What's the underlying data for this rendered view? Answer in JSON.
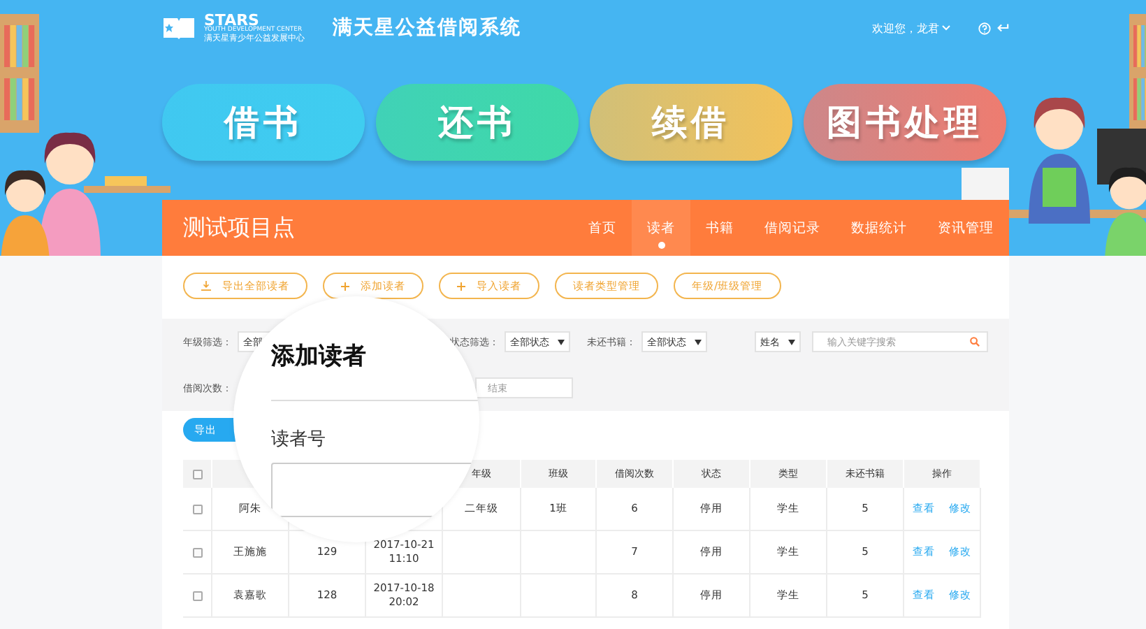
{
  "header": {
    "logo": {
      "name": "STARS",
      "subtitle": "YOUTH DEVELOPMENT CENTER",
      "subtitle_cn": "满天星青少年公益发展中心"
    },
    "title": "满天星公益借阅系统",
    "user": "欢迎您，龙君"
  },
  "actions": [
    {
      "label": "借书",
      "color": "#3fcdf0"
    },
    {
      "label": "还书",
      "color": "#3fd9a8"
    },
    {
      "label": "续借",
      "color": "#f3c25a"
    },
    {
      "label": "图书处理",
      "color": "#ee7c70"
    }
  ],
  "site": {
    "name": "测试项目点",
    "nav": [
      {
        "label": "首页",
        "selected": false
      },
      {
        "label": "读者",
        "selected": true
      },
      {
        "label": "书籍",
        "selected": false
      },
      {
        "label": "借阅记录",
        "selected": false
      },
      {
        "label": "数据统计",
        "selected": false
      },
      {
        "label": "资讯管理",
        "selected": false
      }
    ]
  },
  "toolbar": [
    {
      "label": "导出全部读者",
      "kind": "download"
    },
    {
      "label": "添加读者",
      "kind": "add"
    },
    {
      "label": "导入读者",
      "kind": "add"
    },
    {
      "label": "读者类型管理",
      "kind": "plain"
    },
    {
      "label": "年级/班级管理",
      "kind": "plain"
    }
  ],
  "filters": [
    {
      "label": "年级筛选：",
      "value": "全部"
    },
    {
      "label": "状态筛选：",
      "value": "全部状态"
    },
    {
      "label": "未还书籍：",
      "value": "全部状态"
    }
  ],
  "search": {
    "field": "姓名",
    "placeholder": "输入关键字搜索"
  },
  "borrow_count": {
    "label": "借阅次数：",
    "end_placeholder": "结束"
  },
  "export_button": "导出",
  "table": {
    "all_checked": false,
    "columns": [
      "年级",
      "班级",
      "借阅次数",
      "状态",
      "类型",
      "未还书籍",
      "操作"
    ],
    "rows": [
      {
        "checked": false,
        "name": "阿朱",
        "grade": "二年级",
        "class": "1班",
        "count": "6",
        "status": "停用",
        "type": "学生",
        "unreturned": "5",
        "actions": [
          "查看",
          "修改"
        ]
      },
      {
        "checked": false,
        "name": "王施施",
        "number": "129",
        "date": "2017-10-21 11:10",
        "count": "7",
        "status": "停用",
        "type": "学生",
        "unreturned": "5",
        "actions": [
          "查看",
          "修改"
        ]
      },
      {
        "checked": false,
        "name": "袁嘉歌",
        "number": "128",
        "date": "2017-10-18 20:02",
        "count": "8",
        "status": "停用",
        "type": "学生",
        "unreturned": "5",
        "actions": [
          "查看",
          "修改"
        ]
      }
    ]
  },
  "dialog": {
    "title": "添加读者",
    "field_label": "读者号"
  }
}
